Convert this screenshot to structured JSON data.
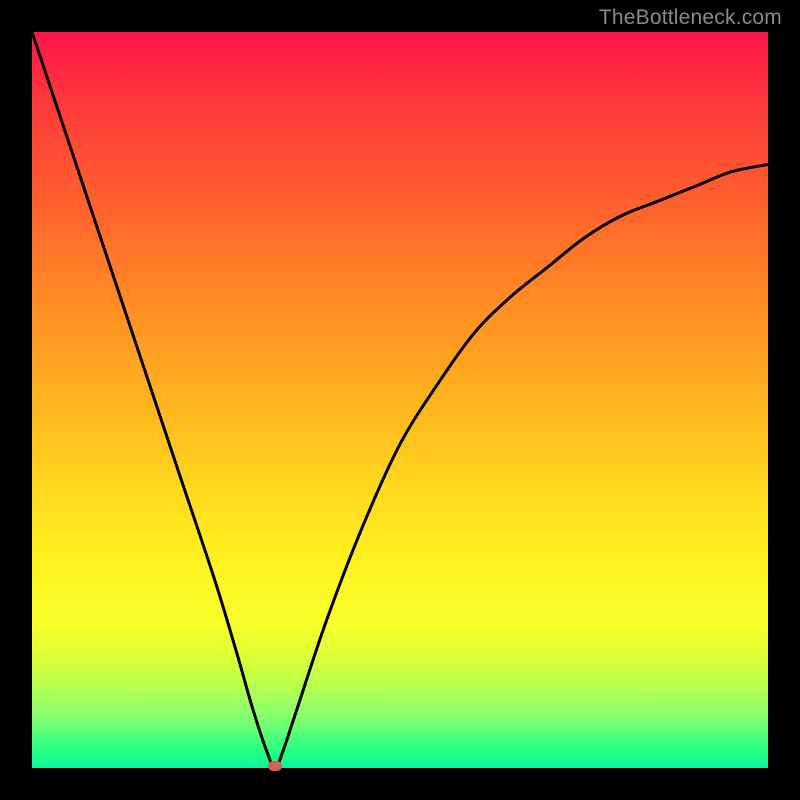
{
  "watermark": "TheBottleneck.com",
  "colors": {
    "background": "#000000",
    "gradient_top": "#ff154a",
    "gradient_mid": "#ffd81f",
    "gradient_bottom": "#0cf598",
    "curve": "#000000",
    "marker": "#d26257"
  },
  "chart_data": {
    "type": "line",
    "title": "",
    "xlabel": "",
    "ylabel": "",
    "xlim": [
      0,
      100
    ],
    "ylim": [
      0,
      100
    ],
    "grid": false,
    "legend": false,
    "series": [
      {
        "name": "bottleneck-curve",
        "x": [
          0,
          5,
          10,
          15,
          20,
          25,
          28,
          30,
          32,
          33,
          34,
          36,
          40,
          45,
          50,
          55,
          60,
          65,
          70,
          75,
          80,
          85,
          90,
          95,
          100
        ],
        "y": [
          100,
          85,
          70,
          55,
          40,
          25,
          15,
          8,
          2,
          0,
          2,
          8,
          20,
          33,
          44,
          52,
          59,
          64,
          68,
          72,
          75,
          77,
          79,
          81,
          82
        ]
      }
    ],
    "annotations": [
      {
        "name": "minimum-marker",
        "x": 33,
        "y": 0
      }
    ]
  }
}
